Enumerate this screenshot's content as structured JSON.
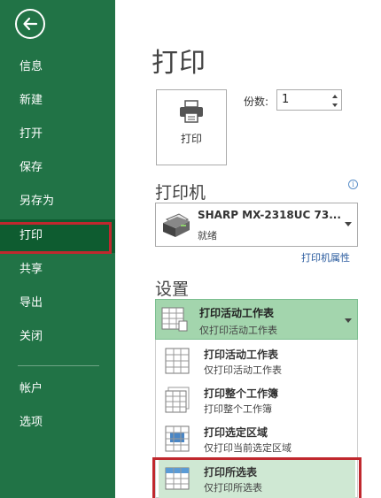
{
  "sidebar": {
    "items": [
      {
        "label": "信息"
      },
      {
        "label": "新建"
      },
      {
        "label": "打开"
      },
      {
        "label": "保存"
      },
      {
        "label": "另存为"
      },
      {
        "label": "打印"
      },
      {
        "label": "共享"
      },
      {
        "label": "导出"
      },
      {
        "label": "关闭"
      },
      {
        "label": "帐户"
      },
      {
        "label": "选项"
      }
    ],
    "active_item": "打印"
  },
  "main": {
    "title": "打印",
    "print_button_label": "打印",
    "copies_label": "份数:",
    "copies_value": "1",
    "printer_section_title": "打印机",
    "printer": {
      "name": "SHARP MX-2318UC 73...",
      "status": "就绪"
    },
    "printer_properties_link": "打印机属性",
    "settings_title": "设置",
    "scope": {
      "main": "打印活动工作表",
      "sub": "仅打印活动工作表"
    },
    "options": [
      {
        "main": "打印活动工作表",
        "sub": "仅打印活动工作表"
      },
      {
        "main": "打印整个工作簿",
        "sub": "打印整个工作簿"
      },
      {
        "main": "打印选定区域",
        "sub": "仅打印当前选定区域"
      },
      {
        "main": "打印所选表",
        "sub": "仅打印所选表"
      }
    ]
  },
  "colors": {
    "sidebar": "#217346",
    "highlight": "#c0282e",
    "selected": "#a3d5ad"
  }
}
